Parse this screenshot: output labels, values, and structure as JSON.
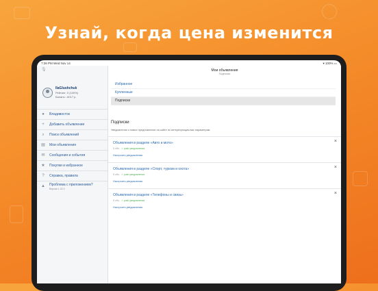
{
  "headline": "Узнай, когда цена изменится",
  "status_bar": {
    "time": "7:26 PM",
    "date": "Wed Nov 14",
    "battery": "100%"
  },
  "profile": {
    "name": "IlaGlushchuk",
    "rating": "Рейтинг: 0 (100%)",
    "balance": "Баланс: -6017 р."
  },
  "sidebar": {
    "items": [
      {
        "label": "Владивосток",
        "icon": "location-pin-icon"
      },
      {
        "label": "Добавить объявление",
        "icon": "plus-icon"
      },
      {
        "label": "Поиск объявлений",
        "icon": "search-icon"
      },
      {
        "label": "Мои объявления",
        "icon": "list-icon"
      },
      {
        "label": "Сообщения и события",
        "icon": "envelope-icon"
      },
      {
        "label": "Покупки и избранное",
        "icon": "star-icon"
      },
      {
        "label": "Справка, правила",
        "icon": "help-icon"
      },
      {
        "label": "Проблема с приложением?",
        "sub": "Версия 1.22.0",
        "icon": "warning-icon"
      }
    ]
  },
  "content": {
    "title": "Мои объявления",
    "subtitle": "Подписки",
    "tabs": [
      {
        "label": "Избранное",
        "active": false
      },
      {
        "label": "Купленные",
        "active": false
      },
      {
        "label": "Подписки",
        "active": true
      }
    ],
    "section_title": "Подписки",
    "section_desc": "Уведомления о новых предложениях на сайте по интересующим вас параметрам.",
    "subscriptions": [
      {
        "title": "Объявления в разделе «Авто и мото»",
        "meta_left": "5 объ.",
        "meta_ok": "✓ push-уведомления",
        "settings": "Настроить уведомления"
      },
      {
        "title": "Объявления в разделе «Спорт, туризм и охота»",
        "meta_left": "5 объ.",
        "meta_ok": "✓ push-уведомления",
        "settings": "Настроить уведомления"
      },
      {
        "title": "Объявления в разделе «Телефоны и связь»",
        "meta_left": "5 объ.",
        "meta_ok": "✓ push-уведомления",
        "settings": "Настроить уведомления"
      }
    ]
  }
}
